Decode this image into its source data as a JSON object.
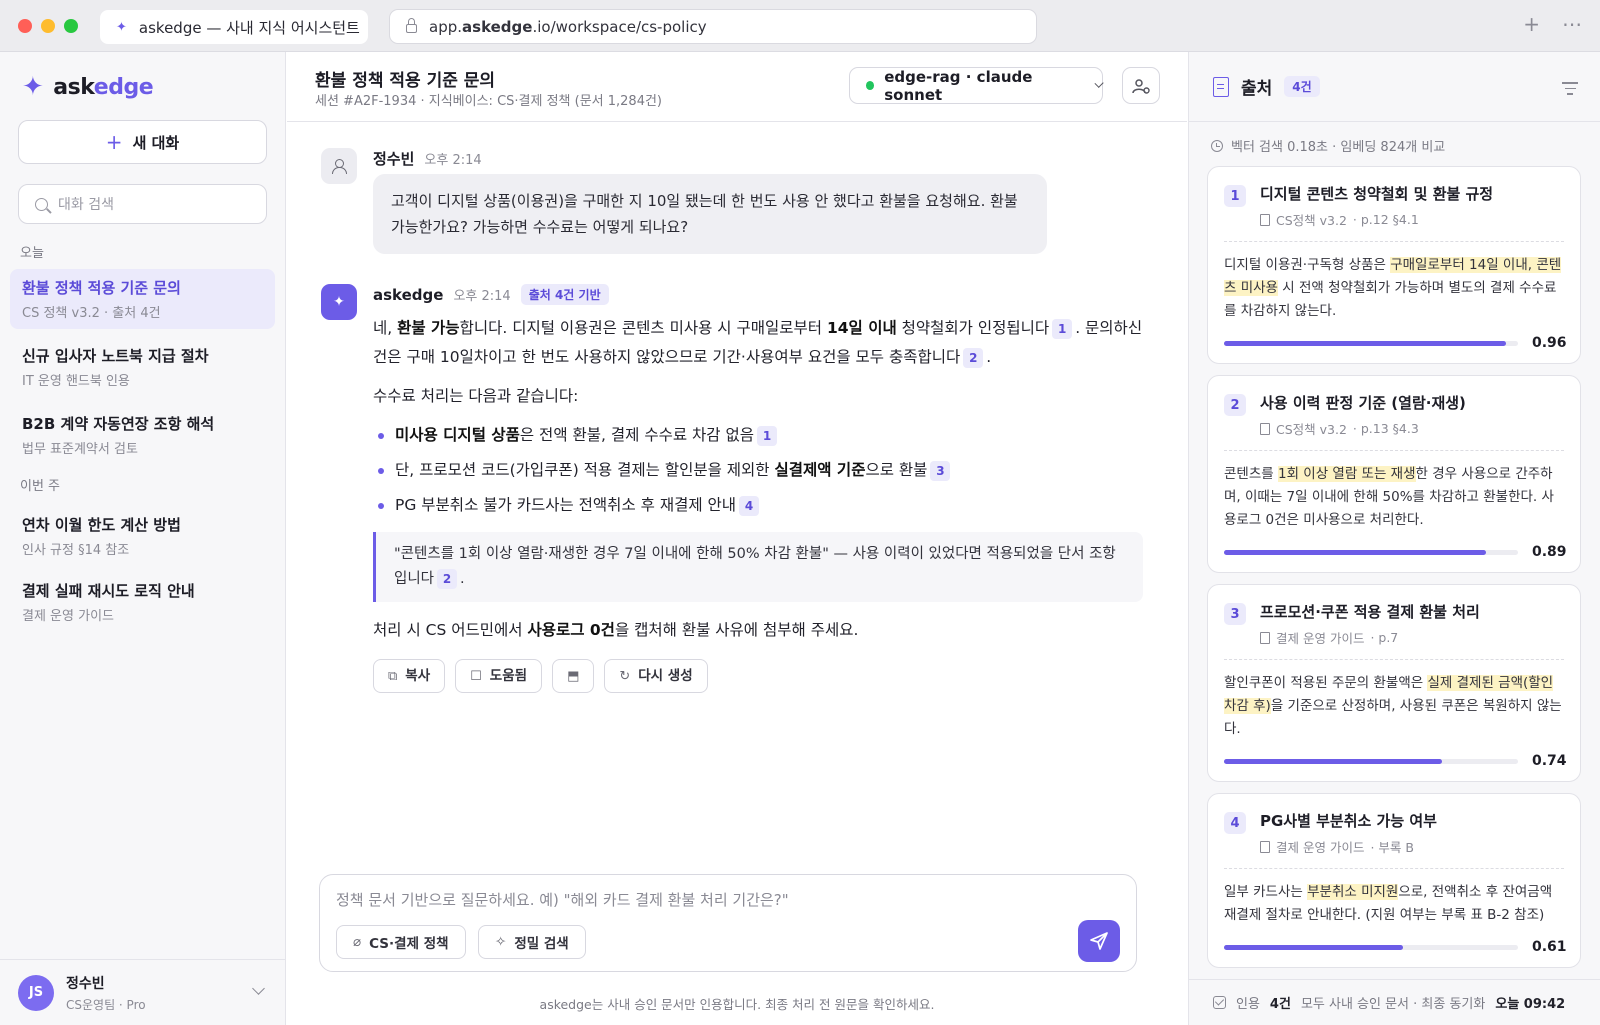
{
  "browser": {
    "tab_title": "askedge — 사내 지식 어시스턴트",
    "url_prefix": "app.",
    "url_domain": "askedge",
    "url_suffix": ".io/workspace/cs-policy"
  },
  "sidebar": {
    "brand_prefix": "ask",
    "brand_suffix": "edge",
    "new_chat": "새 대화",
    "search_placeholder": "대화 검색",
    "today_label": "오늘",
    "week_label": "이번 주",
    "today": [
      {
        "title": "환불 정책 적용 기준 문의",
        "subtitle": "CS 정책 v3.2 · 출처 4건"
      },
      {
        "title": "신규 입사자 노트북 지급 절차",
        "subtitle": "IT 운영 핸드북 인용"
      },
      {
        "title": "B2B 계약 자동연장 조항 해석",
        "subtitle": "법무 표준계약서 검토"
      }
    ],
    "week": [
      {
        "title": "연차 이월 한도 계산 방법",
        "subtitle": "인사 규정 §14 참조"
      },
      {
        "title": "결제 실패 재시도 로직 안내",
        "subtitle": "결제 운영 가이드"
      }
    ],
    "user": {
      "initials": "JS",
      "name": "정수빈",
      "role": "CS운영팀 · Pro"
    }
  },
  "main": {
    "title": "환불 정책 적용 기준 문의",
    "subtitle": "세션 #A2F-1934 · 지식베이스: CS·결제 정책 (문서 1,284건)",
    "model": "edge-rag · claude sonnet",
    "user_msg": {
      "name": "정수빈",
      "time": "오후 2:14",
      "text": "고객이 디지털 상품(이용권)을 구매한 지 10일 됐는데 한 번도 사용 안 했다고 환불을 요청해요. 환불 가능한가요? 가능하면 수수료는 어떻게 되나요?"
    },
    "bot_msg": {
      "name": "askedge",
      "time": "오후 2:14",
      "badge": "출처 4건 기반",
      "p1_a": "네, ",
      "p1_b": "환불 가능",
      "p1_c": "합니다. 디지털 이용권은 콘텐츠 미사용 시 구매일로부터 ",
      "p1_d": "14일 이내",
      "p1_e": " 청약철회가 인정됩니다",
      "p1_f": ". 문의하신 건은 구매 10일차이고 한 번도 사용하지 않았으므로 기간·사용여부 요건을 모두 충족합니다",
      "p1_g": ".",
      "p2": "수수료 처리는 다음과 같습니다:",
      "b1_a": "미사용 디지털 상품",
      "b1_b": "은 전액 환불, 결제 수수료 차감 없음",
      "b2_a": "단, 프로모션 코드(가입쿠폰) 적용 결제는 할인분을 제외한 ",
      "b2_b": "실결제액 기준",
      "b2_c": "으로 환불",
      "b3": "PG 부분취소 불가 카드사는 전액취소 후 재결제 안내",
      "quote": "\"콘텐츠를 1회 이상 열람·재생한 경우 7일 이내에 한해 50% 차감 환불\" — 사용 이력이 있었다면 적용되었을 단서 조항입니다",
      "quote_end": ".",
      "p3_a": "처리 시 CS 어드민에서 ",
      "p3_b": "사용로그 0건",
      "p3_c": "을 캡처해 환불 사유에 첨부해 주세요.",
      "cites": {
        "c1": "1",
        "c2": "2",
        "c3": "1",
        "c4": "3",
        "c5": "4",
        "c6": "2"
      },
      "actions": {
        "copy": "복사",
        "helpful": "도움됨",
        "regenerate": "다시 생성"
      }
    },
    "composer": {
      "placeholder": "정책 문서 기반으로 질문하세요. 예) \"해외 카드 결제 환불 처리 기간은?\"",
      "chip_kb": "CS·결제 정책",
      "chip_search": "정밀 검색"
    },
    "disclaimer": "askedge는 사내 승인 문서만 인용합니다. 최종 처리 전 원문을 확인하세요."
  },
  "panel": {
    "title": "출처",
    "count": "4건",
    "info": "벡터 검색 0.18초 · 임베딩 824개 비교",
    "sources": [
      {
        "num": "1",
        "title": "디지털 콘텐츠 청약철회 및 환불 규정",
        "doc": "CS정책 v3.2",
        "loc": "· p.12 §4.1",
        "pre": "디지털 이용권·구독형 상품은 ",
        "hl": "구매일로부터 14일 이내, 콘텐츠 미사용",
        "post": " 시 전액 청약철회가 가능하며 별도의 결제 수수료를 차감하지 않는다.",
        "score": "0.96"
      },
      {
        "num": "2",
        "title": "사용 이력 판정 기준 (열람·재생)",
        "doc": "CS정책 v3.2",
        "loc": "· p.13 §4.3",
        "pre": "콘텐츠를 ",
        "hl": "1회 이상 열람 또는 재생",
        "post": "한 경우 사용으로 간주하며, 이때는 7일 이내에 한해 50%를 차감하고 환불한다. 사용로그 0건은 미사용으로 처리한다.",
        "score": "0.89"
      },
      {
        "num": "3",
        "title": "프로모션·쿠폰 적용 결제 환불 처리",
        "doc": "결제 운영 가이드",
        "loc": "· p.7",
        "pre": "할인쿠폰이 적용된 주문의 환불액은 ",
        "hl": "실제 결제된 금액(할인 차감 후)",
        "post": "을 기준으로 산정하며, 사용된 쿠폰은 복원하지 않는다.",
        "score": "0.74"
      },
      {
        "num": "4",
        "title": "PG사별 부분취소 가능 여부",
        "doc": "결제 운영 가이드",
        "loc": "· 부록 B",
        "pre": "일부 카드사는 ",
        "hl": "부분취소 미지원",
        "post": "으로, 전액취소 후 잔여금액 재결제 절차로 안내한다. (지원 여부는 부록 표 B-2 참조)",
        "score": "0.61"
      }
    ],
    "footer": {
      "label": "인용",
      "count": "4건",
      "status": "모두 사내 승인 문서 · 최종 동기화",
      "time": "오늘 09:42"
    }
  },
  "colors": {
    "accent": "#6c5ce7",
    "highlight": "#fdf3c4",
    "status_online": "#22c55e"
  }
}
